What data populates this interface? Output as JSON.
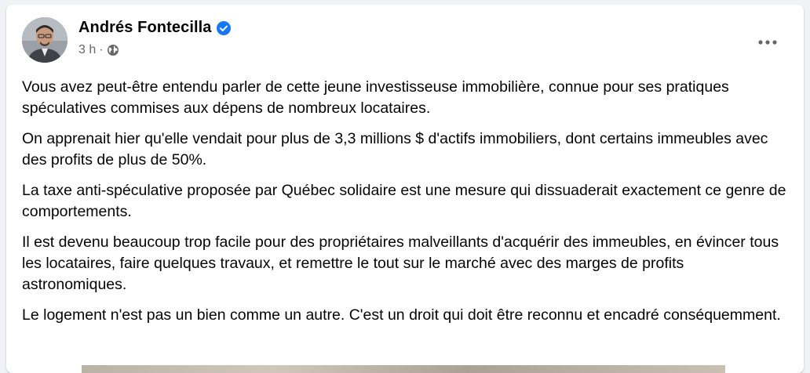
{
  "post": {
    "author": "Andrés Fontecilla",
    "time": "3 h",
    "separator": "·",
    "paragraphs": [
      "Vous avez peut-être entendu parler de cette jeune investisseuse immobilière, connue pour ses pratiques spéculatives commises aux dépens de nombreux locataires.",
      "On apprenait hier qu'elle vendait pour plus de 3,3 millions $ d'actifs immobiliers, dont certains immeubles avec des profits de plus de 50%.",
      "La taxe anti-spéculative proposée par Québec solidaire est une mesure qui dissuaderait exactement ce genre de comportements.",
      "Il est devenu beaucoup trop facile pour des propriétaires malveillants d'acquérir des immeubles, en évincer tous les locataires, faire quelques travaux, et remettre le tout sur le marché avec des marges de profits astronomiques.",
      "Le logement n'est pas un bien comme un autre. C'est un droit qui doit être reconnu et encadré conséquemment."
    ]
  },
  "icons": {
    "verified": "verified-badge-icon",
    "audience": "globe-icon",
    "more": "more-options-icon"
  },
  "colors": {
    "verified": "#1877f2",
    "secondary_text": "#65676b",
    "primary_text": "#050505",
    "background": "#f0f2f5"
  }
}
